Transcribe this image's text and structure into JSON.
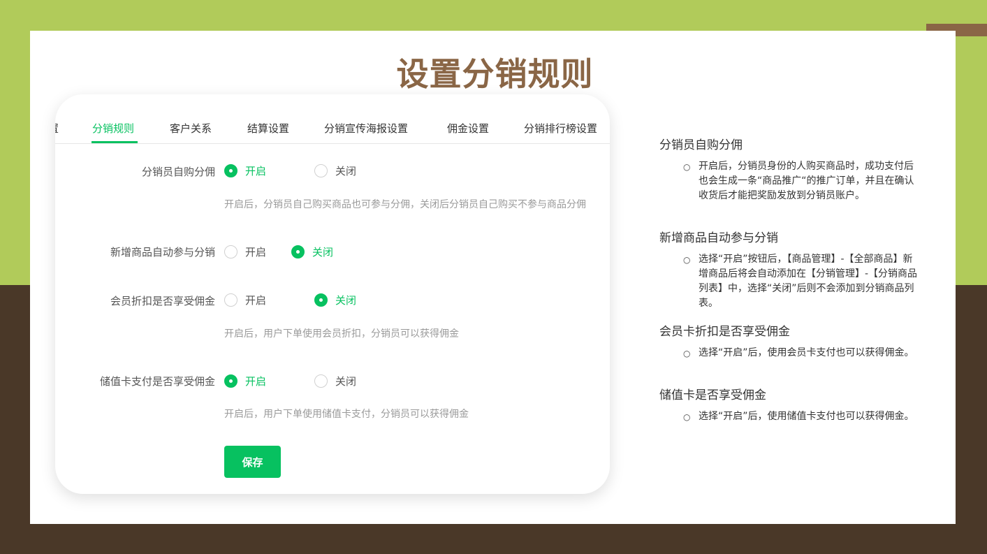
{
  "slide": {
    "title": "设置分销规则"
  },
  "tabs": [
    {
      "label": "置"
    },
    {
      "label": "分销规则"
    },
    {
      "label": "客户关系"
    },
    {
      "label": "结算设置"
    },
    {
      "label": "分销宣传海报设置"
    },
    {
      "label": "佣金设置"
    },
    {
      "label": "分销排行榜设置"
    }
  ],
  "settings": [
    {
      "label": "分销员自购分佣",
      "on_label": "开启",
      "off_label": "关闭",
      "selected": "开启",
      "hint": "开启后，分销员自己购买商品也可参与分佣，关闭后分销员自己购买不参与商品分佣"
    },
    {
      "label": "新增商品自动参与分销",
      "on_label": "开启",
      "off_label": "关闭",
      "selected": "关闭",
      "hint": ""
    },
    {
      "label": "会员折扣是否享受佣金",
      "on_label": "开启",
      "off_label": "关闭",
      "selected": "关闭",
      "hint": "开启后，用户下单使用会员折扣，分销员可以获得佣金"
    },
    {
      "label": "储值卡支付是否享受佣金",
      "on_label": "开启",
      "off_label": "关闭",
      "selected": "开启",
      "hint": "开启后，用户下单使用储值卡支付，分销员可以获得佣金"
    }
  ],
  "save_button": {
    "label": "保存"
  },
  "notes": [
    {
      "heading": "分销员自购分佣",
      "bullet": "○",
      "text": "开启后，分销员身份的人购买商品时，成功支付后也会生成一条“商品推广“的推广订单，并且在确认收货后才能把奖励发放到分销员账户。"
    },
    {
      "heading": "新增商品自动参与分销",
      "bullet": "○",
      "text": "选择“开启”按钮后，【商品管理】-【全部商品】新增商品后将会自动添加在【分销管理】-【分销商品列表】中，选择“关闭”后则不会添加到分销商品列表。"
    },
    {
      "heading": "会员卡折扣是否享受佣金",
      "bullet": "○",
      "text": "选择“开启”后，使用会员卡支付也可以获得佣金。"
    },
    {
      "heading": "储值卡是否享受佣金",
      "bullet": "○",
      "text": "选择“开启”后，使用储值卡支付也可以获得佣金。"
    }
  ],
  "colors": {
    "accent_green": "#07c160",
    "title_brown": "#8a6646",
    "bg_green": "#b1cb5a",
    "bg_dark": "#4a3828"
  }
}
